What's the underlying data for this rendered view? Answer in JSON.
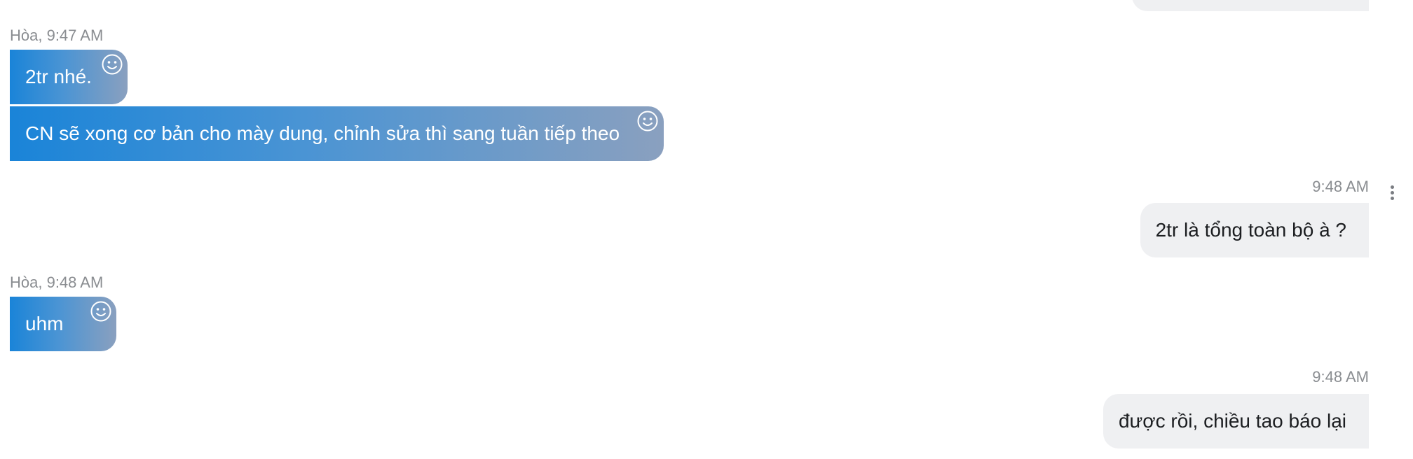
{
  "messages": [
    {
      "sender": "",
      "time": "",
      "text": "",
      "direction": "outgoing"
    },
    {
      "sender": "Hòa",
      "time": "9:47 AM",
      "meta": "Hòa, 9:47 AM",
      "text": "2tr nhé.",
      "direction": "incoming"
    },
    {
      "text": "CN sẽ xong cơ bản cho mày dung, chỉnh sửa thì sang tuần tiếp theo",
      "direction": "incoming"
    },
    {
      "time": "9:48 AM",
      "text": "2tr là tổng toàn bộ à ?",
      "direction": "outgoing"
    },
    {
      "sender": "Hòa",
      "time": "9:48 AM",
      "meta": "Hòa, 9:48 AM",
      "text": "uhm",
      "direction": "incoming"
    },
    {
      "time": "9:48 AM",
      "text": "được rồi, chiều tao báo lại",
      "direction": "outgoing"
    }
  ],
  "icons": {
    "reaction": "smiley-face-icon",
    "more_options": "vertical-ellipsis-icon"
  },
  "colors": {
    "incoming_gradient_start": "#1a84d8",
    "incoming_gradient_end": "#8aa0bf",
    "outgoing_bubble": "#eff0f2",
    "meta_text": "#8a8d91",
    "incoming_text": "#ffffff",
    "outgoing_text": "#1c1e21"
  }
}
